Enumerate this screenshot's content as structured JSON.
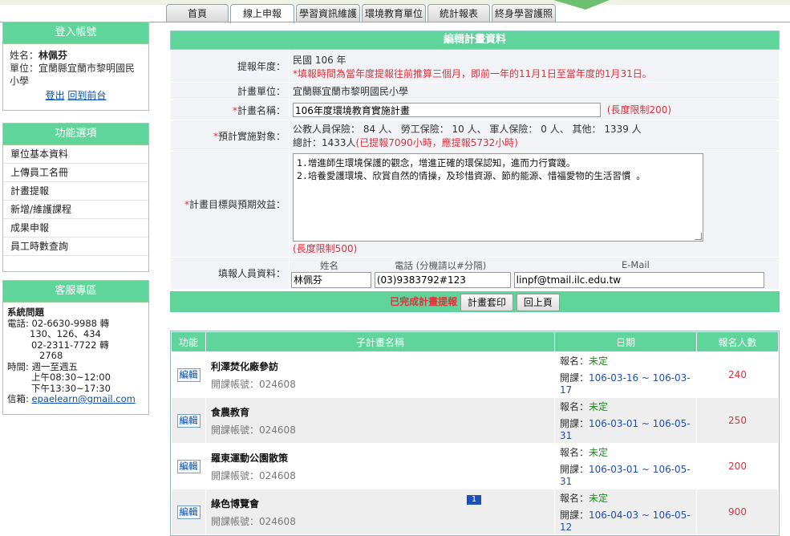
{
  "tabs": [
    "首頁",
    "線上申報",
    "學習資訊維護",
    "環境教育單位",
    "統計報表",
    "終身學習護照"
  ],
  "login": {
    "header": "登入帳號",
    "name_label": "姓名：",
    "name": "林佩芬",
    "unit_label": "單位：",
    "unit": "宜蘭縣宜蘭市黎明國民小學",
    "logout": "登出",
    "back_front": "回到前台"
  },
  "menu": {
    "header": "功能選項",
    "items": [
      "單位基本資料",
      "上傳員工名冊",
      "計畫提報",
      "新增/維護課程",
      "成果申報",
      "員工時數查詢"
    ]
  },
  "service": {
    "header": "客服專區",
    "title": "系統問題",
    "phone_label": "電話: 02-6630-9988 轉",
    "phone_ext": "130、126、434",
    "phone2": "02-2311-7722 轉",
    "phone2_ext": "2768",
    "time_label": "時間: 週一至週五",
    "time_am": "上午08:30~12:00",
    "time_pm": "下午13:30~17:30",
    "mail_label": "信箱:",
    "mail": "epaelearn@gmail.com"
  },
  "form": {
    "title": "編輯計畫資料",
    "year_label": "提報年度：",
    "year_value": "民國 106 年",
    "year_note": "*填報時間為當年度提報往前推算三個月，即前一年的11月1日至當年度的1月31日。",
    "unit_label": "計畫單位：",
    "unit_value": "宜蘭縣宜蘭市黎明國民小學",
    "name_label": "計畫名稱：",
    "name_value": "106年度環境教育實施計畫",
    "name_limit": "(長度限制200)",
    "target_label": "預計實施對象：",
    "target_line1": "公教人員保險： 84 人、 勞工保險： 10 人、 軍人保險： 0 人、 其他： 1339 人",
    "target_total": "總計：1433人",
    "target_hours": "(已提報7090小時，應提報5732小時)",
    "goal_label": "計畫目標與預期效益：",
    "goal_text": "1.增進師生環境保護的觀念，增進正確的環保認知，進而力行實踐。\n2.培養愛護環境、欣賞自然的情操，及珍惜資源、節約能源、惜福愛物的生活習慣 。",
    "goal_limit": "(長度限制500)",
    "filler_label": "填報人員資料：",
    "col_name": "姓名",
    "col_phone": "電話 (分機請以#分隔)",
    "col_email": "E-Mail",
    "filler_name": "林佩芬",
    "filler_phone": "(03)9383792#123",
    "filler_email": "linpf@tmail.ilc.edu.tw",
    "done_text": "已完成計畫提報",
    "print_btn": "計畫套印",
    "back_btn": "回上頁"
  },
  "sub": {
    "headers": [
      "功能",
      "子計畫名稱",
      "日期",
      "報名人數"
    ],
    "edit_label": "編輯",
    "acc_prefix": "開課帳號：",
    "signup_prefix": "報名：",
    "course_prefix": "開課：",
    "rows": [
      {
        "name": "利澤焚化廠參訪",
        "account": "024608",
        "signup": "未定",
        "dates": "106-03-16 ~ 106-03-17",
        "count": "240"
      },
      {
        "name": "食農教育",
        "account": "024608",
        "signup": "未定",
        "dates": "106-03-01 ~ 106-05-31",
        "count": "250"
      },
      {
        "name": "羅東運動公園散策",
        "account": "024608",
        "signup": "未定",
        "dates": "106-03-01 ~ 106-05-31",
        "count": "200"
      },
      {
        "name": "綠色博覽會",
        "account": "024608",
        "signup": "未定",
        "dates": "106-04-03 ~ 106-05-12",
        "count": "900"
      }
    ]
  },
  "pager": {
    "page": "1"
  },
  "colors": {
    "header_green": "#5fd49b",
    "required_red": "#e0303a",
    "link_blue": "#0a4fa8"
  }
}
